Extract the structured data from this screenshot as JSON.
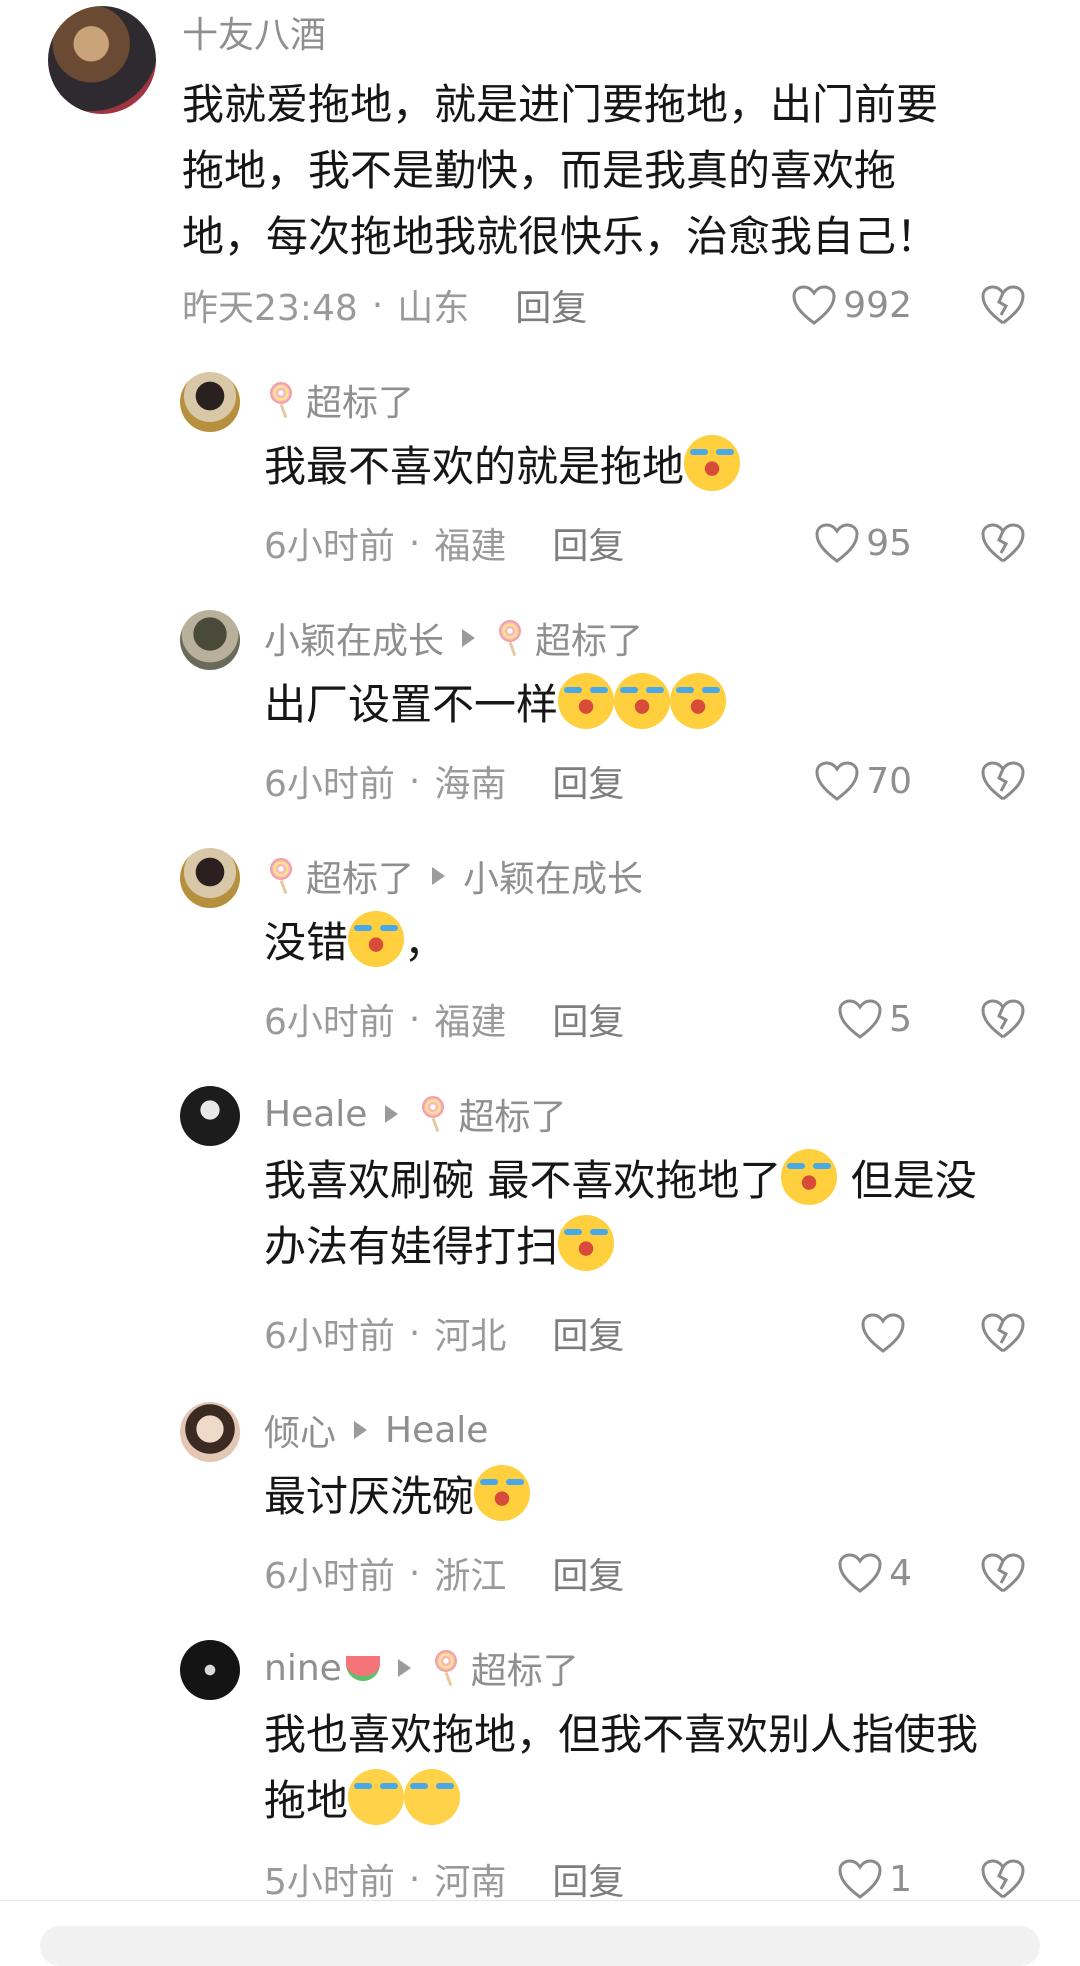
{
  "comments": [
    {
      "user": "十友八酒",
      "lines": [
        "我就爱拖地，就是进门要拖地，出门前要",
        "拖地，我不是勤快，而是我真的喜欢拖",
        "地，每次拖地我就很快乐，治愈我自己！"
      ],
      "time": "昨天23:48",
      "location": "山东",
      "reply_label": "回复",
      "likes": "992"
    }
  ],
  "replies": [
    {
      "user": "超标了",
      "text": "我最不喜欢的就是拖地",
      "time": "6小时前",
      "location": "福建",
      "reply_label": "回复",
      "likes": "95"
    },
    {
      "user": "小颖在成长",
      "target": "超标了",
      "text": "出厂设置不一样",
      "time": "6小时前",
      "location": "海南",
      "reply_label": "回复",
      "likes": "70"
    },
    {
      "user": "超标了",
      "target": "小颖在成长",
      "text": "没错",
      "text_after_emoji": "，",
      "time": "6小时前",
      "location": "福建",
      "reply_label": "回复",
      "likes": "5"
    },
    {
      "user": "Heale",
      "target": "超标了",
      "lines": [
        "我喜欢刷碗 最不喜欢拖地了",
        " 但是没",
        "办法有娃得打扫"
      ],
      "time": "6小时前",
      "location": "河北",
      "reply_label": "回复",
      "likes": ""
    },
    {
      "user": "倾心",
      "target": "Heale",
      "text": "最讨厌洗碗",
      "time": "6小时前",
      "location": "浙江",
      "reply_label": "回复",
      "likes": "4"
    },
    {
      "user": "nine",
      "target": "超标了",
      "lines": [
        "我也喜欢拖地，但我不喜欢别人指使我",
        "拖地"
      ],
      "time": "5小时前",
      "location": "河南",
      "reply_label": "回复",
      "likes": "1"
    }
  ],
  "separator": "·",
  "icons": {
    "like": "heart-outline-icon",
    "dislike": "broken-heart-icon",
    "badge": "lollipop-icon",
    "reply_arrow": "triangle-right-icon"
  }
}
